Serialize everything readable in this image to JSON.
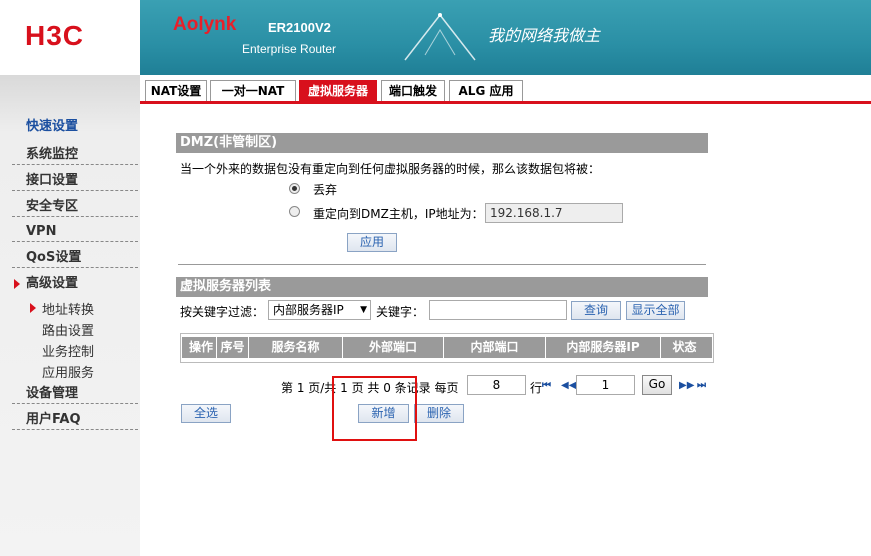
{
  "header": {
    "logo": "H3C",
    "brand": "Aolynk",
    "model": "ER2100V2",
    "subtitle": "Enterprise Router",
    "slogan": "我的网络我做主"
  },
  "sidebar": {
    "items": [
      {
        "label": "快速设置"
      },
      {
        "label": "系统监控"
      },
      {
        "label": "接口设置"
      },
      {
        "label": "安全专区"
      },
      {
        "label": "VPN"
      },
      {
        "label": "QoS设置"
      },
      {
        "label": "高级设置"
      },
      {
        "label": "设备管理"
      },
      {
        "label": "用户FAQ"
      }
    ],
    "subitems": [
      {
        "label": "地址转换"
      },
      {
        "label": "路由设置"
      },
      {
        "label": "业务控制"
      },
      {
        "label": "应用服务"
      }
    ]
  },
  "tabs": [
    {
      "label": "NAT设置"
    },
    {
      "label": "一对一NAT"
    },
    {
      "label": "虚拟服务器"
    },
    {
      "label": "端口触发"
    },
    {
      "label": "ALG 应用"
    }
  ],
  "dmz": {
    "title": "DMZ(非管制区)",
    "description": "当一个外来的数据包没有重定向到任何虚拟服务器的时候，那么该数据包将被：",
    "option_discard": "丢弃",
    "option_redirect": "重定向到DMZ主机，IP地址为：",
    "ip_value": "192.168.1.7",
    "apply_label": "应用"
  },
  "vserver": {
    "title": "虚拟服务器列表",
    "filter_label": "按关键字过滤：",
    "filter_select": "内部服务器IP",
    "keyword_label": "关键字：",
    "keyword_value": "",
    "query_label": "查询",
    "show_all_label": "显示全部",
    "columns": [
      "操作",
      "序号",
      "服务名称",
      "外部端口",
      "内部端口",
      "内部服务器IP",
      "状态"
    ]
  },
  "pagination": {
    "summary": "第 1 页/共 1 页 共 0 条记录 每页",
    "per_page": "8",
    "rows_label": "行",
    "page_value": "1",
    "go_label": "Go"
  },
  "actions": {
    "select_all_label": "全选",
    "new_label": "新增",
    "delete_label": "删除"
  }
}
